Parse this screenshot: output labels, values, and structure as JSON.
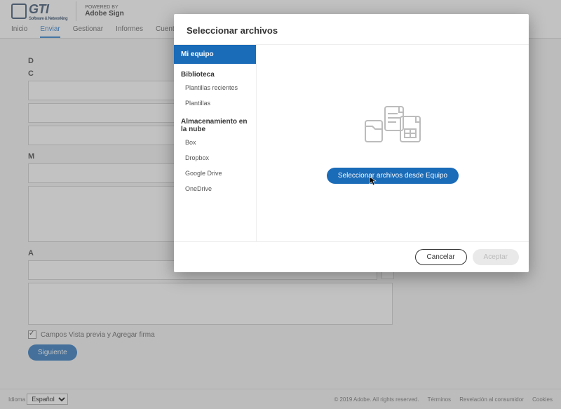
{
  "header": {
    "brand": "GTI",
    "brand_tag": "Software & Networking",
    "powered_label": "POWERED BY",
    "powered_brand": "Adobe Sign"
  },
  "nav": {
    "inicio": "Inicio",
    "enviar": "Enviar",
    "gestionar": "Gestionar",
    "informes": "Informes",
    "cuenta": "Cuenta"
  },
  "form": {
    "checkbox_label": "Campos Vista previa y Agregar firma",
    "next": "Siguiente"
  },
  "footer": {
    "lang_label": "Idioma",
    "lang_value": "Español",
    "copyright": "© 2019 Adobe. All rights reserved.",
    "link_terms": "Términos",
    "link_notice": "Revelación al consumidor",
    "link_cookies": "Cookies"
  },
  "modal": {
    "title": "Seleccionar archivos",
    "sidebar": {
      "mi_equipo": "Mi equipo",
      "biblioteca": "Biblioteca",
      "plantillas_recientes": "Plantillas recientes",
      "plantillas": "Plantillas",
      "cloud_header": "Almacenamiento en la nube",
      "box": "Box",
      "dropbox": "Dropbox",
      "gdrive": "Google Drive",
      "onedrive": "OneDrive"
    },
    "select_button": "Seleccionar archivos desde Equipo",
    "cancel": "Cancelar",
    "accept": "Aceptar"
  }
}
